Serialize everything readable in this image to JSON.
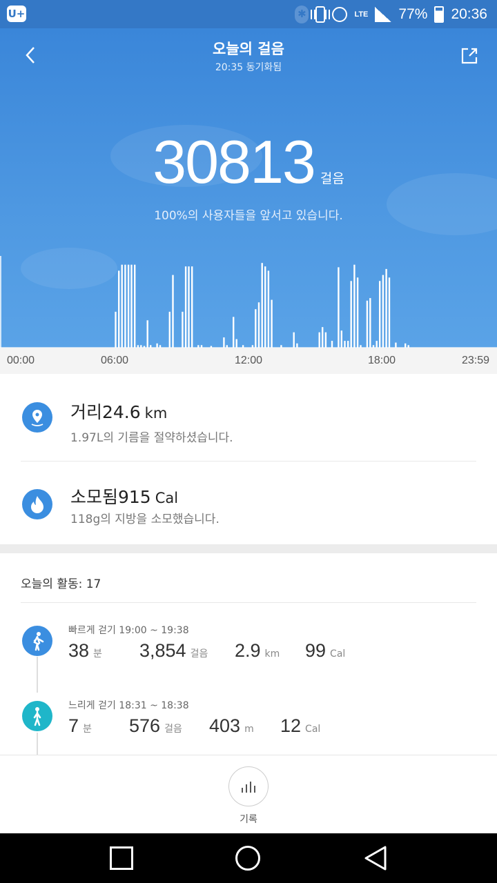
{
  "status_bar": {
    "battery": "77%",
    "time": "20:36",
    "network": "LTE",
    "left_icon": "U+"
  },
  "header": {
    "title": "오늘의 걸음",
    "sync": "20:35 동기화됨"
  },
  "steps": {
    "value": "30813",
    "unit": "걸음",
    "rank_text": "100%의 사용자들을 앞서고 있습니다."
  },
  "timeline_labels": [
    "00:00",
    "06:00",
    "12:00",
    "18:00",
    "23:59"
  ],
  "chart_data": {
    "type": "bar",
    "title": "",
    "xlabel": "",
    "ylabel": "",
    "x_range": [
      "00:00",
      "23:59"
    ],
    "color": "#ffffff",
    "bars": [
      {
        "t": 5.0,
        "v": 0.42
      },
      {
        "t": 5.17,
        "v": 0.9
      },
      {
        "t": 5.33,
        "v": 0.97
      },
      {
        "t": 5.5,
        "v": 0.97
      },
      {
        "t": 5.67,
        "v": 0.97
      },
      {
        "t": 5.83,
        "v": 0.97
      },
      {
        "t": 6.0,
        "v": 0.97
      },
      {
        "t": 6.17,
        "v": 0.03
      },
      {
        "t": 6.33,
        "v": 0.03
      },
      {
        "t": 6.5,
        "v": 0.02
      },
      {
        "t": 6.67,
        "v": 0.32
      },
      {
        "t": 6.83,
        "v": 0.03
      },
      {
        "t": 7.17,
        "v": 0.05
      },
      {
        "t": 7.33,
        "v": 0.03
      },
      {
        "t": 7.83,
        "v": 0.42
      },
      {
        "t": 8.0,
        "v": 0.85
      },
      {
        "t": 8.5,
        "v": 0.42
      },
      {
        "t": 8.67,
        "v": 0.95
      },
      {
        "t": 8.83,
        "v": 0.95
      },
      {
        "t": 9.0,
        "v": 0.95
      },
      {
        "t": 9.33,
        "v": 0.03
      },
      {
        "t": 9.5,
        "v": 0.03
      },
      {
        "t": 10.0,
        "v": 0.02
      },
      {
        "t": 10.67,
        "v": 0.12
      },
      {
        "t": 10.83,
        "v": 0.03
      },
      {
        "t": 11.17,
        "v": 0.36
      },
      {
        "t": 11.33,
        "v": 0.1
      },
      {
        "t": 11.67,
        "v": 0.03
      },
      {
        "t": 12.17,
        "v": 0.03
      },
      {
        "t": 12.33,
        "v": 0.45
      },
      {
        "t": 12.5,
        "v": 0.53
      },
      {
        "t": 12.67,
        "v": 0.99
      },
      {
        "t": 12.83,
        "v": 0.95
      },
      {
        "t": 13.0,
        "v": 0.9
      },
      {
        "t": 13.17,
        "v": 0.56
      },
      {
        "t": 13.67,
        "v": 0.03
      },
      {
        "t": 14.33,
        "v": 0.18
      },
      {
        "t": 14.5,
        "v": 0.05
      },
      {
        "t": 15.67,
        "v": 0.18
      },
      {
        "t": 15.83,
        "v": 0.24
      },
      {
        "t": 16.0,
        "v": 0.18
      },
      {
        "t": 16.33,
        "v": 0.08
      },
      {
        "t": 16.67,
        "v": 0.94
      },
      {
        "t": 16.83,
        "v": 0.2
      },
      {
        "t": 17.0,
        "v": 0.08
      },
      {
        "t": 17.17,
        "v": 0.08
      },
      {
        "t": 17.33,
        "v": 0.78
      },
      {
        "t": 17.5,
        "v": 0.97
      },
      {
        "t": 17.67,
        "v": 0.82
      },
      {
        "t": 17.83,
        "v": 0.03
      },
      {
        "t": 18.17,
        "v": 0.55
      },
      {
        "t": 18.33,
        "v": 0.58
      },
      {
        "t": 18.5,
        "v": 0.03
      },
      {
        "t": 18.67,
        "v": 0.08
      },
      {
        "t": 18.83,
        "v": 0.78
      },
      {
        "t": 19.0,
        "v": 0.85
      },
      {
        "t": 19.17,
        "v": 0.92
      },
      {
        "t": 19.33,
        "v": 0.82
      },
      {
        "t": 19.67,
        "v": 0.06
      },
      {
        "t": 20.17,
        "v": 0.05
      },
      {
        "t": 20.33,
        "v": 0.03
      }
    ]
  },
  "distance": {
    "label": "거리24.6",
    "unit": "km",
    "sub": "1.97L의 기름을 절약하셨습니다."
  },
  "calories": {
    "label": "소모됨915",
    "unit": "Cal",
    "sub": "118g의 지방을 소모했습니다."
  },
  "activity": {
    "header": "오늘의 활동:  17",
    "items": [
      {
        "title": "빠르게 걷기 19:00 ~ 19:38",
        "color": "#3b8ee0",
        "stats": [
          {
            "v": "38",
            "u": "분"
          },
          {
            "v": "3,854",
            "u": "걸음"
          },
          {
            "v": "2.9",
            "u": "km"
          },
          {
            "v": "99",
            "u": "Cal"
          }
        ]
      },
      {
        "title": "느리게 걷기 18:31 ~ 18:38",
        "color": "#1fb6c9",
        "stats": [
          {
            "v": "7",
            "u": "분"
          },
          {
            "v": "576",
            "u": "걸음"
          },
          {
            "v": "403",
            "u": "m"
          },
          {
            "v": "12",
            "u": "Cal"
          }
        ]
      }
    ]
  },
  "bottom": {
    "record_label": "기록"
  }
}
